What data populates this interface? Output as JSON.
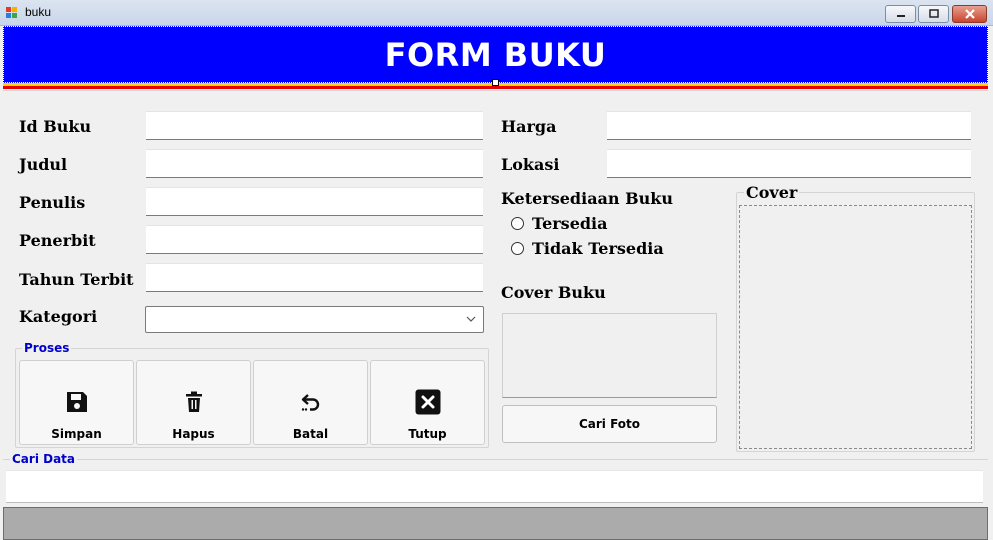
{
  "window": {
    "title": "buku",
    "controls": [
      "minimize-icon",
      "maximize-icon",
      "close-icon"
    ]
  },
  "banner": {
    "title": "FORM BUKU",
    "background": "#0000ff",
    "stripe_colors": [
      "#ffd200",
      "#e60000"
    ]
  },
  "fields": {
    "id_buku": {
      "label": "Id Buku",
      "value": ""
    },
    "judul": {
      "label": "Judul",
      "value": ""
    },
    "penulis": {
      "label": "Penulis",
      "value": ""
    },
    "penerbit": {
      "label": "Penerbit",
      "value": ""
    },
    "tahun_terbit": {
      "label": "Tahun Terbit",
      "value": ""
    },
    "kategori": {
      "label": "Kategori",
      "value": ""
    },
    "harga": {
      "label": "Harga",
      "value": ""
    },
    "lokasi": {
      "label": "Lokasi",
      "value": ""
    }
  },
  "ketersediaan": {
    "label": "Ketersediaan Buku",
    "options": [
      "Tersedia",
      "Tidak Tersedia"
    ]
  },
  "cover_buku": {
    "label": "Cover Buku",
    "button": "Cari Foto"
  },
  "cover_group": {
    "legend": "Cover"
  },
  "proses": {
    "legend": "Proses",
    "buttons": [
      {
        "label": "Simpan",
        "icon": "save-icon"
      },
      {
        "label": "Hapus",
        "icon": "trash-icon"
      },
      {
        "label": "Batal",
        "icon": "undo-icon"
      },
      {
        "label": "Tutup",
        "icon": "close-box-icon"
      }
    ]
  },
  "cari_data": {
    "legend": "Cari Data",
    "value": ""
  },
  "colors": {
    "legend_text": "#0000cc",
    "grid_bg": "#ababab"
  }
}
